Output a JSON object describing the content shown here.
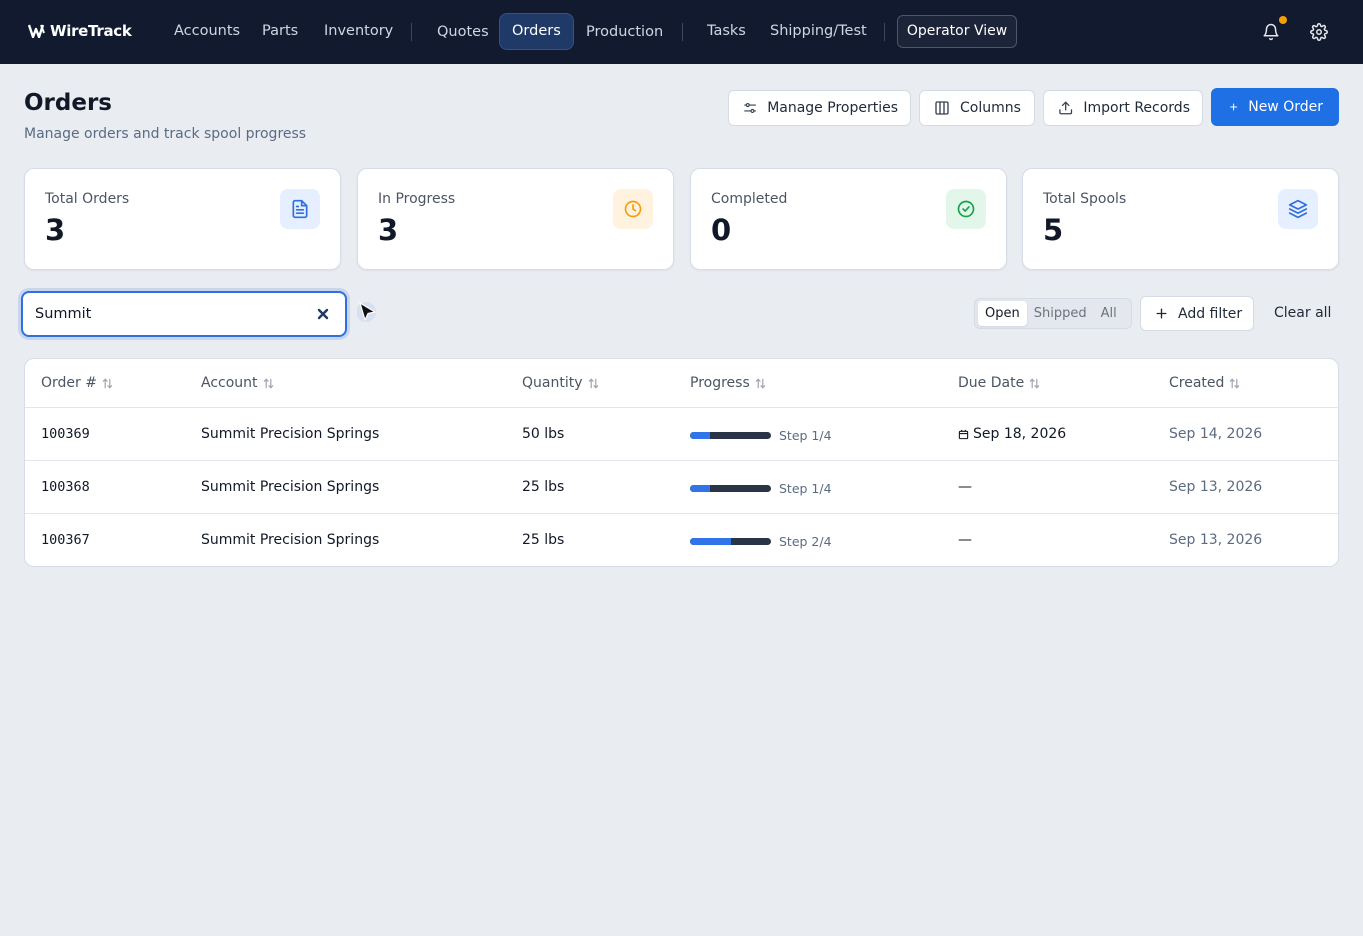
{
  "app": {
    "logo_text": "WireTrack"
  },
  "nav": {
    "items": [
      {
        "label": "Accounts"
      },
      {
        "label": "Parts"
      },
      {
        "label": "Inventory"
      },
      {
        "label": "Quotes"
      },
      {
        "label": "Orders",
        "active": true
      },
      {
        "label": "Production"
      },
      {
        "label": "Tasks"
      },
      {
        "label": "Shipping/Test"
      }
    ],
    "operator_view": "Operator View",
    "icons": [
      "bell-icon",
      "gear-icon"
    ],
    "notification_dot_color": "#f59e0b"
  },
  "header": {
    "title": "Orders",
    "subtitle": "Manage orders and track spool progress",
    "buttons": {
      "manage_properties": "Manage Properties",
      "columns": "Columns",
      "import_records": "Import Records",
      "new_order": "New Order"
    }
  },
  "stats": [
    {
      "label": "Total Orders",
      "value": "3",
      "icon": "document-icon",
      "color": "#2f6fe0"
    },
    {
      "label": "In Progress",
      "value": "3",
      "icon": "clock-icon",
      "color": "#f59e0b"
    },
    {
      "label": "Completed",
      "value": "0",
      "icon": "check-circle-icon",
      "color": "#16a34a"
    },
    {
      "label": "Total Spools",
      "value": "5",
      "icon": "layers-icon",
      "color": "#2f6fe0"
    }
  ],
  "filters": {
    "search_value": "Summit",
    "segments": [
      {
        "label": "Open",
        "active": true
      },
      {
        "label": "Shipped"
      },
      {
        "label": "All"
      }
    ],
    "add_filter": "Add filter",
    "clear_all": "Clear all"
  },
  "table": {
    "columns": [
      "Order #",
      "Account",
      "Quantity",
      "Progress",
      "Due Date",
      "Created"
    ],
    "rows": [
      {
        "order": "100369",
        "account": "Summit Precision Springs",
        "quantity": "50 lbs",
        "progress": 0.25,
        "progress_label": "Step 1/4",
        "due": "Sep 18, 2026",
        "created": "Sep 14, 2026"
      },
      {
        "order": "100368",
        "account": "Summit Precision Springs",
        "quantity": "25 lbs",
        "progress": 0.25,
        "progress_label": "Step 1/4",
        "due": "—",
        "created": "Sep 13, 2026"
      },
      {
        "order": "100367",
        "account": "Summit Precision Springs",
        "quantity": "25 lbs",
        "progress": 0.5,
        "progress_label": "Step 2/4",
        "due": "—",
        "created": "Sep 13, 2026"
      }
    ]
  },
  "colors": {
    "nav_bg": "#111a2e",
    "accent": "#1f6fe5",
    "page_bg": "#e9edf2"
  }
}
